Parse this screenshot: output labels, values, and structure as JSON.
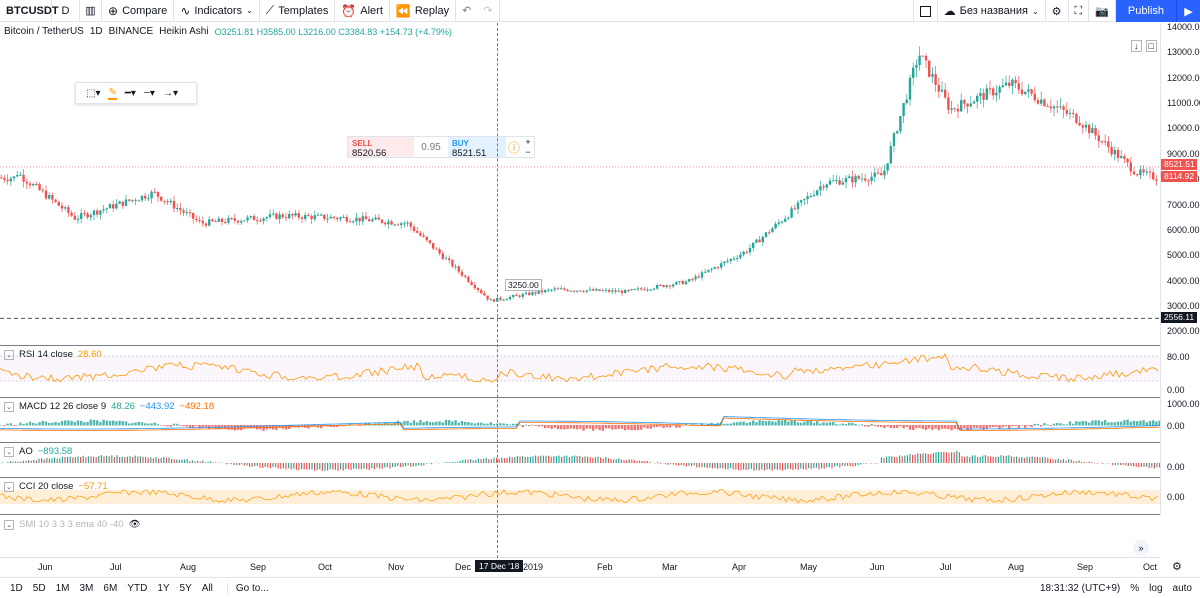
{
  "toolbar": {
    "symbol": "BTCUSDT",
    "interval": "D",
    "compare": "Compare",
    "indicators": "Indicators",
    "templates": "Templates",
    "alert": "Alert",
    "replay": "Replay",
    "layout_name": "Без названия",
    "publish": "Publish"
  },
  "legend": {
    "title": "Bitcoin / TetherUS",
    "interval": "1D",
    "exchange": "BINANCE",
    "chart_style": "Heikin Ashi",
    "o": "O3251.81",
    "h": "H3585.00",
    "l": "L3216.00",
    "c": "C3384.83",
    "chg": "+154.73 (+4.79%)"
  },
  "trade": {
    "sell_label": "SELL",
    "sell_price": "8520.56",
    "spread": "0.95",
    "buy_label": "BUY",
    "buy_price": "8521.51"
  },
  "price_scale": [
    "14000.00",
    "13000.00",
    "12000.00",
    "11000.00",
    "10000.00",
    "9000.00",
    "8000.00",
    "7000.00",
    "6000.00",
    "5000.00",
    "4000.00",
    "3000.00",
    "2000.00"
  ],
  "price_tags": {
    "current": "8521.51",
    "last": "8114.92",
    "crosshair": "2556.11"
  },
  "crosshair_label": "3250.00",
  "indicators": [
    {
      "name": "RSI 14 close",
      "value": "28.60",
      "scale": [
        "80.00",
        "0.00"
      ]
    },
    {
      "name": "MACD 12 26 close 9",
      "v1": "48.26",
      "v2": "−443.92",
      "v3": "−492.18",
      "scale": [
        "1000.00",
        "0.00"
      ]
    },
    {
      "name": "AO",
      "value": "−893.58",
      "scale": [
        "0.00"
      ]
    },
    {
      "name": "CCI 20 close",
      "value": "−57.71",
      "scale": [
        "0.00"
      ]
    },
    {
      "name": "SMI 10 3 3 3 ema 40 -40"
    }
  ],
  "time_axis": [
    "Jun",
    "Jul",
    "Aug",
    "Sep",
    "Oct",
    "Nov",
    "Dec",
    "2019",
    "Feb",
    "Mar",
    "Apr",
    "May",
    "Jun",
    "Jul",
    "Aug",
    "Sep",
    "Oct"
  ],
  "crosshair_date": "17 Dec '18",
  "bottom": {
    "ranges": [
      "1D",
      "5D",
      "1M",
      "3M",
      "6M",
      "YTD",
      "1Y",
      "5Y",
      "All"
    ],
    "goto": "Go to...",
    "time": "18:31:32 (UTC+9)",
    "pct": "%",
    "log": "log",
    "auto": "auto"
  },
  "colors": {
    "up": "#26a69a",
    "down": "#ef5350",
    "accent": "#2962ff",
    "rsi": "#ff9800"
  },
  "chart_data": {
    "type": "candlestick",
    "style": "Heikin Ashi",
    "x": [
      "2018-05-20",
      "2018-06-15",
      "2018-07-20",
      "2018-08-10",
      "2018-09-15",
      "2018-10-15",
      "2018-11-10",
      "2018-12-17",
      "2019-01-15",
      "2019-02-15",
      "2019-03-15",
      "2019-04-10",
      "2019-05-15",
      "2019-06-10",
      "2019-06-26",
      "2019-07-10",
      "2019-08-06",
      "2019-09-05",
      "2019-10-01",
      "2019-10-10"
    ],
    "close": [
      8300,
      6500,
      7500,
      6300,
      6600,
      6500,
      6300,
      3250,
      3700,
      3600,
      4000,
      5200,
      7900,
      8200,
      13000,
      10800,
      11800,
      10400,
      8300,
      8100
    ],
    "ylim": [
      1500,
      14200
    ],
    "yscale": "linear"
  }
}
